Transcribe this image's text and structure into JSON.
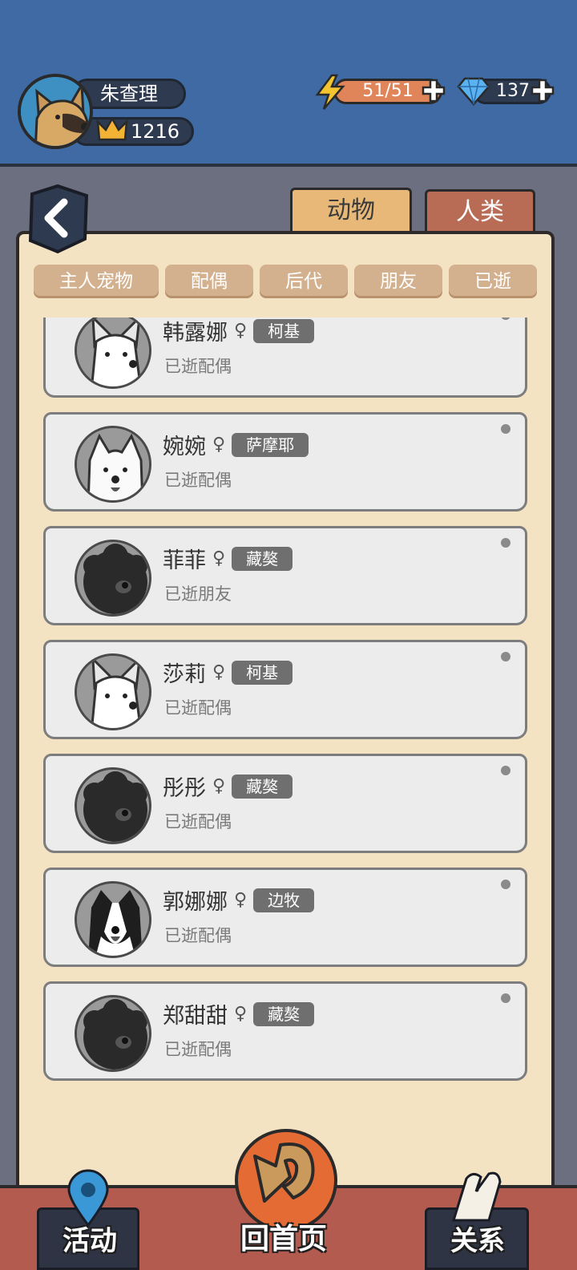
{
  "player": {
    "name": "朱查理",
    "crowns": "1216",
    "energy": "51/51",
    "gems": "137"
  },
  "tabs": [
    {
      "label": "动物",
      "active": true
    },
    {
      "label": "人类",
      "active": false
    }
  ],
  "filters": [
    "主人宠物",
    "配偶",
    "后代",
    "朋友",
    "已逝"
  ],
  "list": [
    {
      "name": "韩露娜",
      "sex": "♀",
      "breed": "柯基",
      "relation": "已逝配偶",
      "icon": "corgi-icon"
    },
    {
      "name": "婉婉",
      "sex": "♀",
      "breed": "萨摩耶",
      "relation": "已逝配偶",
      "icon": "samoyed-icon"
    },
    {
      "name": "菲菲",
      "sex": "♀",
      "breed": "藏獒",
      "relation": "已逝朋友",
      "icon": "mastiff-icon"
    },
    {
      "name": "莎莉",
      "sex": "♀",
      "breed": "柯基",
      "relation": "已逝配偶",
      "icon": "corgi-icon"
    },
    {
      "name": "彤彤",
      "sex": "♀",
      "breed": "藏獒",
      "relation": "已逝配偶",
      "icon": "mastiff-icon"
    },
    {
      "name": "郭娜娜",
      "sex": "♀",
      "breed": "边牧",
      "relation": "已逝配偶",
      "icon": "border-collie-icon"
    },
    {
      "name": "郑甜甜",
      "sex": "♀",
      "breed": "藏獒",
      "relation": "已逝配偶",
      "icon": "mastiff-icon"
    }
  ],
  "bottom_nav": {
    "activity": "活动",
    "home": "回首页",
    "relations": "关系"
  },
  "colors": {
    "topbar": "#3f6aa3",
    "paper": "#f3e3c2",
    "active_tab": "#e7b877",
    "inactive_tab": "#b86b55",
    "energy": "#e0855a"
  }
}
